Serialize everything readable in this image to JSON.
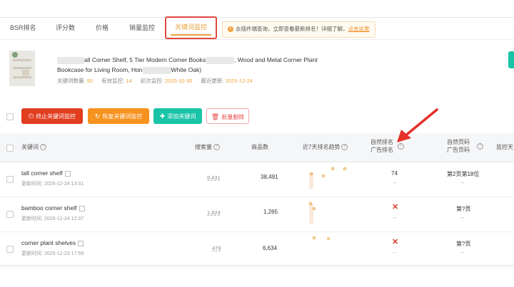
{
  "tabs": [
    {
      "label": "BSR排名"
    },
    {
      "label": "评分数"
    },
    {
      "label": "价格"
    },
    {
      "label": "销量监控"
    },
    {
      "label": "关键词监控"
    }
  ],
  "notice": {
    "text": "去插件端查询，立即查看最新排名！详细了解，",
    "link": "点击这里"
  },
  "product": {
    "title_part1": "all Corner Shelf, 5 Tier Modern Corner Books",
    "title_part2": ", Wood and Metal Corner Plant",
    "title_line2_a": "Bookcase for Living Room, Hon",
    "title_line2_b": "White Oak)",
    "meta": [
      {
        "label": "关键词数量:",
        "value": "50"
      },
      {
        "label": "有效监控:",
        "value": "14"
      },
      {
        "label": "初次监控:",
        "value": "2025-10-30"
      },
      {
        "label": "最近更新:",
        "value": "2025-12-24"
      }
    ]
  },
  "actions": {
    "stop": "终止关键词监控",
    "restore": "恢复关键词监控",
    "add": "添加关键词",
    "delete": "批量删除"
  },
  "columns": {
    "keyword": "关键词",
    "search_volume": "搜索量",
    "product_count": "商品数",
    "trend": "近7天排名趋势",
    "natural_rank": "自然排名",
    "ad_rank": "广告排名",
    "natural_page": "自然页码",
    "ad_page": "广告页码",
    "monitor": "监控天"
  },
  "rows": [
    {
      "keyword": "tall corner shelf",
      "updated": "更新时间: 2025-12-24 13:31",
      "search_volume": "9,431",
      "product_count": "38,491",
      "natural_rank": "74",
      "ad_rank": "--",
      "natural_page": "第2页第18位",
      "ad_page": "--",
      "trend_points": [
        1,
        2,
        3,
        2
      ]
    },
    {
      "keyword": "bamboo corner shelf",
      "updated": "更新时间: 2025-12-24 12:37",
      "search_volume": "1,624",
      "product_count": "1,265",
      "natural_rank": "",
      "ad_rank": "--",
      "natural_page": "第?页",
      "ad_page": "--",
      "trend_points": [
        1,
        2
      ]
    },
    {
      "keyword": "corner plant shelves",
      "updated": "更新时间: 2025-12-23 17:59",
      "search_volume": "479",
      "product_count": "6,634",
      "natural_rank": "",
      "ad_rank": "--",
      "natural_page": "第?页",
      "ad_page": "--",
      "trend_points": [
        1
      ]
    }
  ],
  "colors": {
    "accent": "#e8a23b",
    "danger": "#e23d1f",
    "warning": "#f6921e",
    "teal": "#19c3a6"
  }
}
